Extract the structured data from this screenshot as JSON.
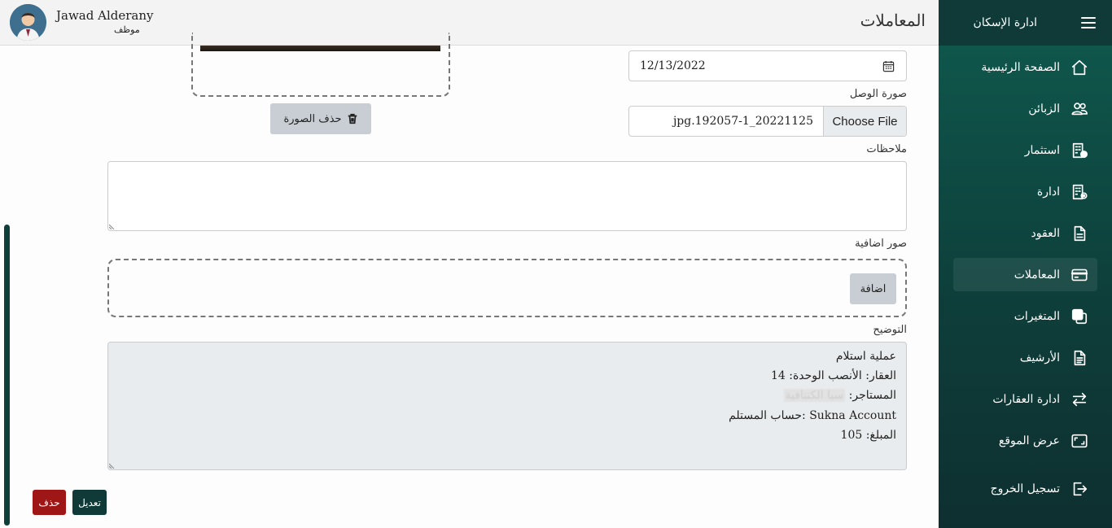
{
  "sidebar": {
    "brand": "ادارة الإسكان",
    "items": [
      {
        "label": "الصفحة الرئيسية",
        "icon": "home-icon"
      },
      {
        "label": "الزبائن",
        "icon": "users-icon"
      },
      {
        "label": "استثمار",
        "icon": "building-check-icon"
      },
      {
        "label": "ادارة",
        "icon": "building-gear-icon"
      },
      {
        "label": "العقود",
        "icon": "document-icon"
      },
      {
        "label": "المعاملات",
        "icon": "credit-card-icon",
        "active": true
      },
      {
        "label": "المتغيرات",
        "icon": "copy-icon"
      },
      {
        "label": "الأرشيف",
        "icon": "archive-document-icon"
      },
      {
        "label": "ادارة العقارات",
        "icon": "arrows-exchange-icon"
      },
      {
        "label": "عرض الموقع",
        "icon": "display-icon"
      }
    ],
    "logout": "تسجيل الخروج"
  },
  "header": {
    "page_title": "المعاملات",
    "user_name": "Jawad Alderany",
    "user_role": "موظف"
  },
  "form": {
    "date_value": "12/13/2022",
    "receipt_label": "صورة الوصل",
    "file_button": "Choose File",
    "file_name": "jpg.192057-1_20221125",
    "delete_image": "حذف الصورة",
    "notes_label": "ملاحظات",
    "notes_value": "",
    "extra_images_label": "صور اضافية",
    "add_button": "اضافة",
    "description_label": "التوضيح",
    "description": {
      "line1": "عملية استلام",
      "line2_label": "العقار: الأنصب الوحدة:",
      "line2_value": "14",
      "line3_label": "المستاجر:",
      "line3_value": "سيا الكتتافية",
      "line4_label": "حساب المستلم:",
      "line4_value": "Sukna Account",
      "line5_label": "المبلغ:",
      "line5_value": "105"
    }
  },
  "actions": {
    "delete": "حذف",
    "edit": "تعديل"
  },
  "colors": {
    "sidebar_bg": "#0f3a38",
    "delete_btn": "#9e1616",
    "edit_btn": "#0f3a38"
  }
}
